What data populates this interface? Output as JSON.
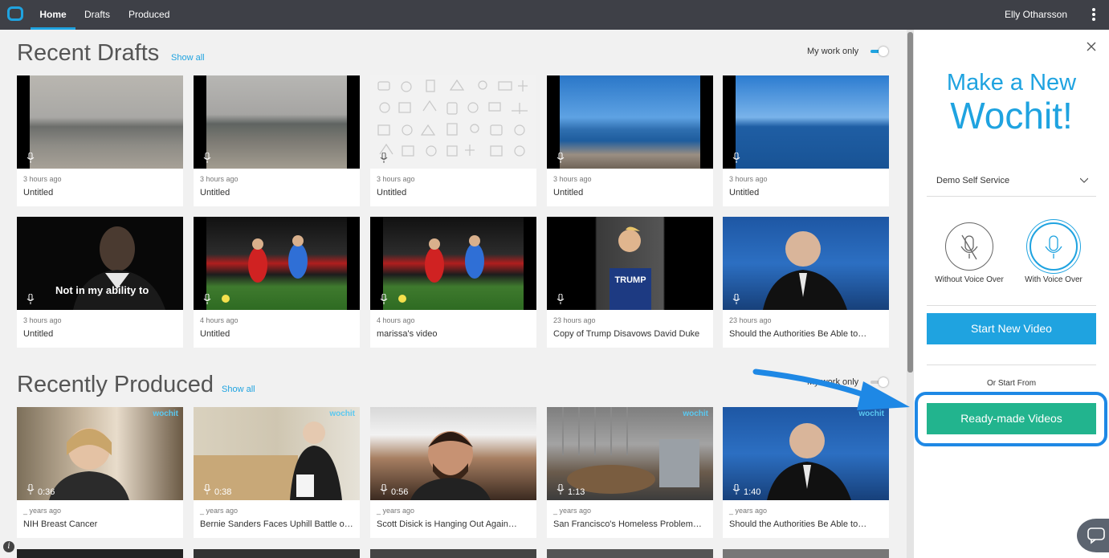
{
  "nav": {
    "home": "Home",
    "drafts": "Drafts",
    "produced": "Produced",
    "user": "Elly Otharsson"
  },
  "recent_drafts": {
    "title": "Recent Drafts",
    "show_all": "Show all",
    "toggle_label": "My work only",
    "cards": [
      {
        "time": "3 hours ago",
        "title": "Untitled"
      },
      {
        "time": "3 hours ago",
        "title": "Untitled"
      },
      {
        "time": "3 hours ago",
        "title": "Untitled"
      },
      {
        "time": "3 hours ago",
        "title": "Untitled"
      },
      {
        "time": "3 hours ago",
        "title": "Untitled"
      },
      {
        "time": "3 hours ago",
        "title": "Untitled",
        "overlay": "Not in my ability to"
      },
      {
        "time": "4 hours ago",
        "title": "Untitled"
      },
      {
        "time": "4 hours ago",
        "title": "marissa's video"
      },
      {
        "time": "23 hours ago",
        "title": "Copy of Trump Disavows David Duke"
      },
      {
        "time": "23 hours ago",
        "title": "Should the Authorities Be Able to…"
      }
    ]
  },
  "recently_produced": {
    "title": "Recently Produced",
    "show_all": "Show all",
    "toggle_label": "My work only",
    "cards": [
      {
        "time": "_ years ago",
        "title": "NIH Breast Cancer",
        "duration": "0:36"
      },
      {
        "time": "_ years ago",
        "title": "Bernie Sanders Faces Uphill Battle o…",
        "duration": "0:38"
      },
      {
        "time": "_ years ago",
        "title": "Scott Disick is Hanging Out Again…",
        "duration": "0:56"
      },
      {
        "time": "_ years ago",
        "title": "San Francisco's Homeless Problem…",
        "duration": "1:13"
      },
      {
        "time": "_ years ago",
        "title": "Should the Authorities Be Able to…",
        "duration": "1:40"
      }
    ],
    "watermark": "wochit"
  },
  "panel": {
    "heading_line1": "Make a New",
    "heading_line2": "Wochit!",
    "org_select": "Demo Self Service",
    "without_voice": "Without Voice Over",
    "with_voice": "With Voice Over",
    "start_button": "Start New Video",
    "or_start_from": "Or Start From",
    "ready_button": "Ready-made Videos"
  },
  "colors": {
    "accent": "#1fa3e0",
    "ready_green": "#22b48e",
    "nav_bg": "#3e4047",
    "highlight_blue": "#1e88e5"
  }
}
